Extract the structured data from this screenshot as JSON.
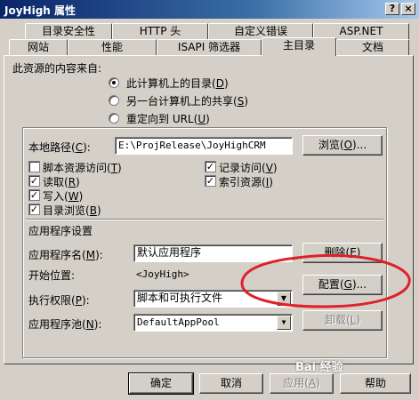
{
  "window": {
    "title": "JoyHigh 属性",
    "help_glyph": "?",
    "close_glyph": "×"
  },
  "tabs_row1": [
    "目录安全性",
    "HTTP 头",
    "自定义错误",
    "ASP.NET"
  ],
  "tabs_row2": [
    "网站",
    "性能",
    "ISAPI 筛选器",
    "主目录",
    "文档"
  ],
  "source": {
    "heading": "此资源的内容来自:",
    "opt_local": "此计算机上的目录",
    "opt_local_key": "D",
    "opt_share": "另一台计算机上的共享",
    "opt_share_key": "S",
    "opt_url": "重定向到 URL",
    "opt_url_key": "U"
  },
  "local_path": {
    "label": "本地路径",
    "label_key": "C",
    "value": "E:\\ProjRelease\\JoyHighCRM",
    "browse_label": "浏览",
    "browse_key": "O"
  },
  "perms": {
    "script_access": "脚本资源访问",
    "script_access_key": "T",
    "read": "读取",
    "read_key": "R",
    "write": "写入",
    "write_key": "W",
    "dir_browse": "目录浏览",
    "dir_browse_key": "B",
    "log_visits": "记录访问",
    "log_visits_key": "V",
    "index_resource": "索引资源",
    "index_resource_key": "I",
    "checked_glyph": "✓"
  },
  "app_settings": {
    "heading": "应用程序设置",
    "app_name_label": "应用程序名",
    "app_name_key": "M",
    "app_name_value": "默认应用程序",
    "remove_label": "删除",
    "remove_key": "E",
    "start_label": "开始位置",
    "start_value": "<JoyHigh>",
    "config_label": "配置",
    "config_key": "G",
    "exec_label": "执行权限",
    "exec_key": "P",
    "exec_value": "脚本和可执行文件",
    "pool_label": "应用程序池",
    "pool_key": "N",
    "pool_value": "DefaultAppPool",
    "unload_label": "卸载",
    "unload_key": "L",
    "dropdown_glyph": "▼"
  },
  "footer": {
    "ok": "确定",
    "cancel": "取消",
    "apply": "应用",
    "apply_key": "A",
    "help": "帮助"
  },
  "watermark": "Bai 经验"
}
